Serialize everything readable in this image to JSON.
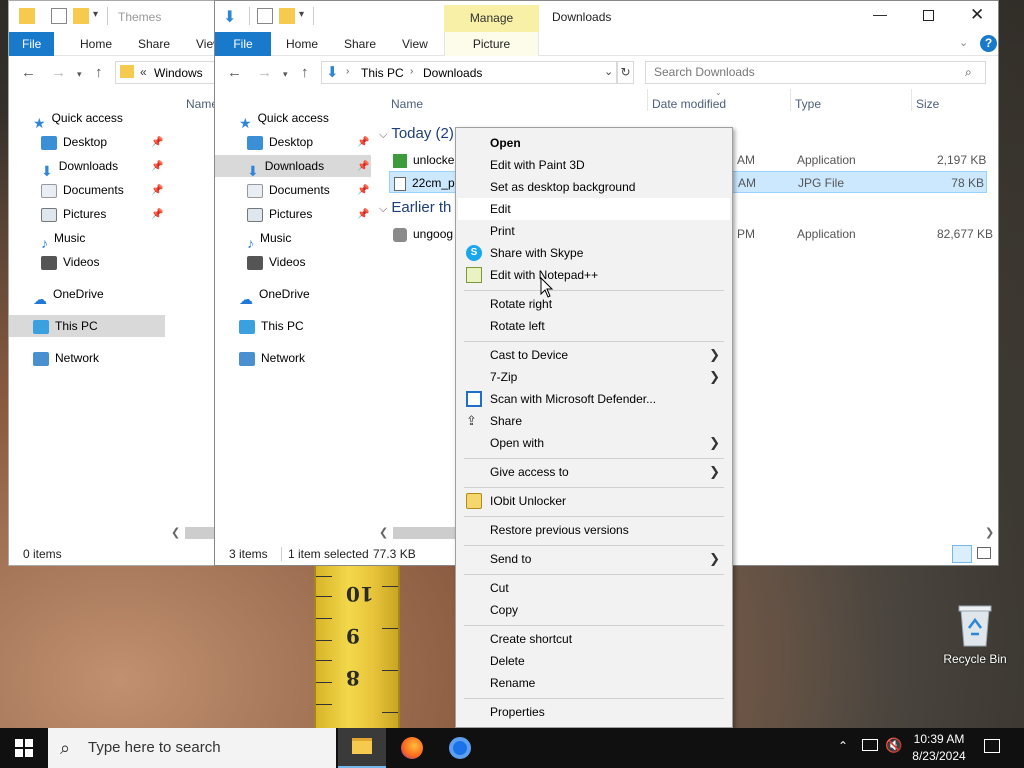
{
  "back_window": {
    "title": "Themes",
    "tabs": [
      "File",
      "Home",
      "Share",
      "View"
    ],
    "address": "Windows",
    "address_prefix": "«",
    "column_name": "Name",
    "nav": [
      {
        "label": "Quick access"
      },
      {
        "label": "Desktop"
      },
      {
        "label": "Downloads"
      },
      {
        "label": "Documents"
      },
      {
        "label": "Pictures"
      },
      {
        "label": "Music"
      },
      {
        "label": "Videos"
      },
      {
        "label": "OneDrive"
      },
      {
        "label": "This PC"
      },
      {
        "label": "Network"
      }
    ],
    "status": "0 items"
  },
  "front_window": {
    "title": "Downloads",
    "manage_tab": "Manage",
    "tabs": [
      "File",
      "Home",
      "Share",
      "View",
      "Picture Tools"
    ],
    "breadcrumb": [
      "This PC",
      "Downloads"
    ],
    "search_placeholder": "Search Downloads",
    "columns": {
      "name": "Name",
      "date": "Date modified",
      "type": "Type",
      "size": "Size"
    },
    "nav": [
      {
        "label": "Quick access"
      },
      {
        "label": "Desktop"
      },
      {
        "label": "Downloads"
      },
      {
        "label": "Documents"
      },
      {
        "label": "Pictures"
      },
      {
        "label": "Music"
      },
      {
        "label": "Videos"
      },
      {
        "label": "OneDrive"
      },
      {
        "label": "This PC"
      },
      {
        "label": "Network"
      }
    ],
    "groups": [
      {
        "label": "Today (2)"
      },
      {
        "label": "Earlier th"
      }
    ],
    "files": [
      {
        "name": "unlocke",
        "date": "AM",
        "type": "Application",
        "size": "2,197 KB"
      },
      {
        "name": "22cm_pe",
        "date": "AM",
        "type": "JPG File",
        "size": "78 KB"
      },
      {
        "name": "ungoog",
        "date": "PM",
        "type": "Application",
        "size": "82,677 KB"
      }
    ],
    "status": {
      "count": "3 items",
      "selected": "1 item selected",
      "size": "77.3 KB"
    },
    "help": "?"
  },
  "context_menu": {
    "items": [
      {
        "label": "Open",
        "bold": true
      },
      {
        "label": "Edit with Paint 3D"
      },
      {
        "label": "Set as desktop background"
      },
      {
        "label": "Edit"
      },
      {
        "label": "Print"
      },
      {
        "label": "Share with Skype",
        "icon": "skype-icon"
      },
      {
        "label": "Edit with Notepad++",
        "icon": "notepadpp-icon"
      },
      {
        "label": "Rotate right"
      },
      {
        "label": "Rotate left"
      },
      {
        "label": "Cast to Device",
        "submenu": true
      },
      {
        "label": "7-Zip",
        "submenu": true
      },
      {
        "label": "Scan with Microsoft Defender...",
        "icon": "defender-icon"
      },
      {
        "label": "Share",
        "icon": "share-icon"
      },
      {
        "label": "Open with",
        "submenu": true
      },
      {
        "label": "Give access to",
        "submenu": true
      },
      {
        "label": "IObit Unlocker",
        "icon": "iobit-icon"
      },
      {
        "label": "Restore previous versions"
      },
      {
        "label": "Send to",
        "submenu": true
      },
      {
        "label": "Cut"
      },
      {
        "label": "Copy"
      },
      {
        "label": "Create shortcut"
      },
      {
        "label": "Delete"
      },
      {
        "label": "Rename"
      },
      {
        "label": "Properties"
      }
    ]
  },
  "desktop": {
    "recycle_bin": "Recycle Bin",
    "tape_numbers": [
      "10",
      "9",
      "8"
    ]
  },
  "taskbar": {
    "search_placeholder": "Type here to search",
    "time": "10:39 AM",
    "date": "8/23/2024"
  },
  "colors": {
    "accent": "#1979ca",
    "manage_tab": "#f7f0a6",
    "selection": "#cce8ff"
  }
}
